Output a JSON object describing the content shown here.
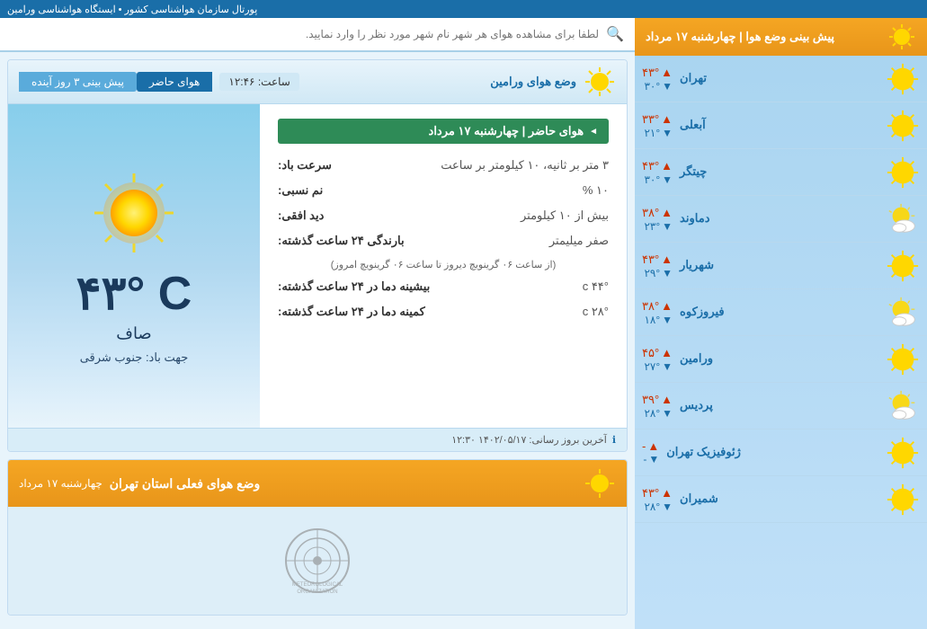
{
  "topbar": {
    "text": "پورتال سازمان هواشناسی کشور • ایستگاه هواشناسی ورامین"
  },
  "sidebar": {
    "header": "پیش بینی وضع هوا | چهارشنبه ۱۷ مرداد",
    "cities": [
      {
        "name": "تهران",
        "high": "۴۳°",
        "low": "۳۰°",
        "icon": "sun"
      },
      {
        "name": "آبعلی",
        "high": "۳۳°",
        "low": "۲۱°",
        "icon": "sun"
      },
      {
        "name": "چیتگر",
        "high": "۴۳°",
        "low": "۳۰°",
        "icon": "sun"
      },
      {
        "name": "دماوند",
        "high": "۳۸°",
        "low": "۲۳°",
        "icon": "partly"
      },
      {
        "name": "شهریار",
        "high": "۴۳°",
        "low": "۲۹°",
        "icon": "sun"
      },
      {
        "name": "فیروزکوه",
        "high": "۳۸°",
        "low": "۱۸°",
        "icon": "partly"
      },
      {
        "name": "ورامین",
        "high": "۴۵°",
        "low": "۲۷°",
        "icon": "sun"
      },
      {
        "name": "پردیس",
        "high": "۳۹°",
        "low": "۲۸°",
        "icon": "partly"
      },
      {
        "name": "ژئوفیزیک تهران",
        "high": "-",
        "low": "-",
        "icon": "none"
      },
      {
        "name": "شمیران",
        "high": "۴۳°",
        "low": "۲۸°",
        "icon": "sun"
      }
    ]
  },
  "search": {
    "placeholder": "لطفا برای مشاهده هوای هر شهر نام شهر مورد نظر را وارد نمایید."
  },
  "weatherCard": {
    "title": "وضع هوای ورامین",
    "tabs": {
      "current": "هوای حاضر",
      "forecast": "پیش بینی ۳ روز آینده"
    },
    "time": "ساعت: ۱۲:۴۶",
    "currentTitle": "هوای حاضر | چهارشنبه ۱۷ مرداد",
    "details": [
      {
        "label": "سرعت باد:",
        "value": "۳ متر بر ثانیه، ۱۰ کیلومتر بر ساعت"
      },
      {
        "label": "نم نسبی:",
        "value": "۱۰ %"
      },
      {
        "label": "دید افقی:",
        "value": "بیش از ۱۰ کیلومتر"
      },
      {
        "label": "بارندگی ۲۴ ساعت گذشته:",
        "value": "صفر میلیمتر",
        "sub": "(از ساعت ۰۶ گرینویچ دیروز تا ساعت ۰۶ گرینویچ امروز)"
      },
      {
        "label": "بیشینه دما در ۲۴ ساعت گذشته:",
        "value": "۴۴° c"
      },
      {
        "label": "کمینه دما در ۲۴ ساعت گذشته:",
        "value": "۲۸° c"
      }
    ],
    "temperature": "۴۳° C",
    "condition": "صاف",
    "windDir": "جهت باد: جنوب شرقی",
    "updated": "آخرین بروز رسانی: ۱۴۰۲/۰۵/۱۷  ۱۲:۳۰"
  },
  "provinceCard": {
    "title": "وضع هوای فعلی استان تهران",
    "subtitle": "چهارشنبه ۱۷ مرداد"
  }
}
